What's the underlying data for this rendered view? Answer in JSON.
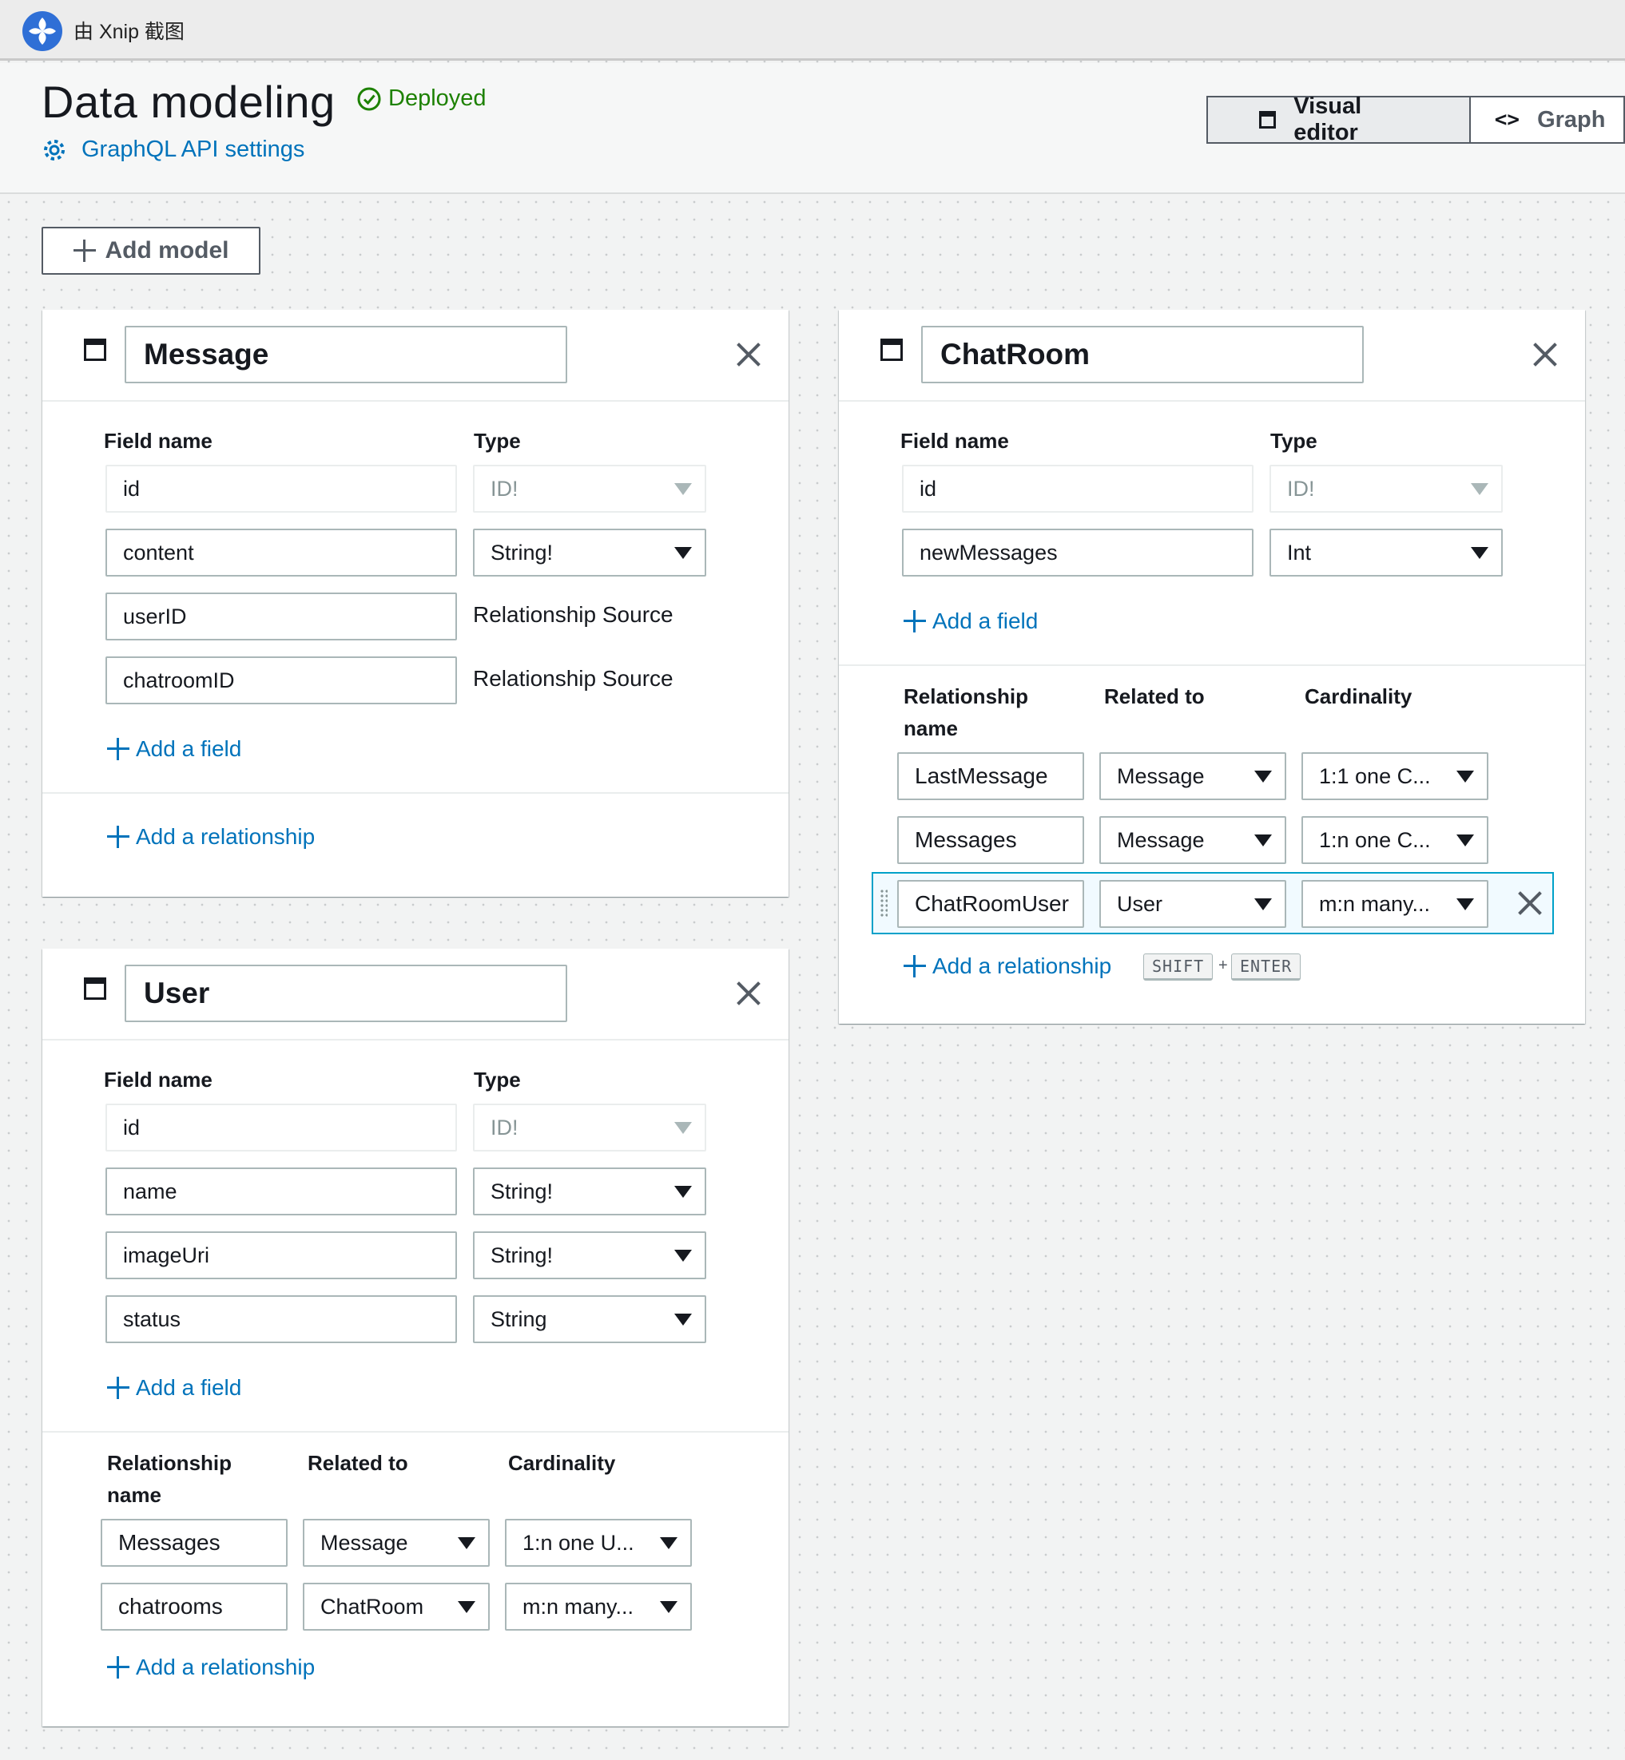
{
  "app_bar": {
    "title": "由 Xnip 截图"
  },
  "header": {
    "title": "Data modeling",
    "status": "Deployed",
    "settings_link": "GraphQL API settings",
    "view_tabs": [
      {
        "label": "Visual editor",
        "selected": true
      },
      {
        "label": "Graph",
        "selected": false
      }
    ]
  },
  "toolbar": {
    "add_model": "Add model"
  },
  "models": {
    "message": {
      "name": "Message",
      "field_col": "Field name",
      "type_col": "Type",
      "fields": [
        {
          "name": "id",
          "type": "ID!"
        },
        {
          "name": "content",
          "type": "String!"
        },
        {
          "name": "userID",
          "type": "Relationship Source"
        },
        {
          "name": "chatroomID",
          "type": "Relationship Source"
        }
      ],
      "add_field": "Add a field",
      "add_relationship": "Add a relationship"
    },
    "chatroom": {
      "name": "ChatRoom",
      "field_col": "Field name",
      "type_col": "Type",
      "fields": [
        {
          "name": "id",
          "type": "ID!"
        },
        {
          "name": "newMessages",
          "type": "Int"
        }
      ],
      "add_field": "Add a field",
      "rel_col_name_1": "Relationship",
      "rel_col_name_2": "name",
      "rel_col_related": "Related to",
      "rel_col_cardinality": "Cardinality",
      "relationships": [
        {
          "name": "LastMessage",
          "related": "Message",
          "cardinality": "1:1 one C..."
        },
        {
          "name": "Messages",
          "related": "Message",
          "cardinality": "1:n one C..."
        },
        {
          "name": "ChatRoomUser",
          "related": "User",
          "cardinality": "m:n many..."
        }
      ],
      "add_relationship": "Add a relationship",
      "shortcut": {
        "key1": "SHIFT",
        "plus": "+",
        "key2": "ENTER"
      }
    },
    "user": {
      "name": "User",
      "field_col": "Field name",
      "type_col": "Type",
      "fields": [
        {
          "name": "id",
          "type": "ID!"
        },
        {
          "name": "name",
          "type": "String!"
        },
        {
          "name": "imageUri",
          "type": "String!"
        },
        {
          "name": "status",
          "type": "String"
        }
      ],
      "add_field": "Add a field",
      "rel_col_name_1": "Relationship",
      "rel_col_name_2": "name",
      "rel_col_related": "Related to",
      "rel_col_cardinality": "Cardinality",
      "relationships": [
        {
          "name": "Messages",
          "related": "Message",
          "cardinality": "1:n one U..."
        },
        {
          "name": "chatrooms",
          "related": "ChatRoom",
          "cardinality": "m:n many..."
        }
      ],
      "add_relationship": "Add a relationship"
    }
  },
  "colors": {
    "link": "#0073bb",
    "status_ok": "#1d8102",
    "border": "#aab7b8",
    "focus": "#00a1c9"
  }
}
